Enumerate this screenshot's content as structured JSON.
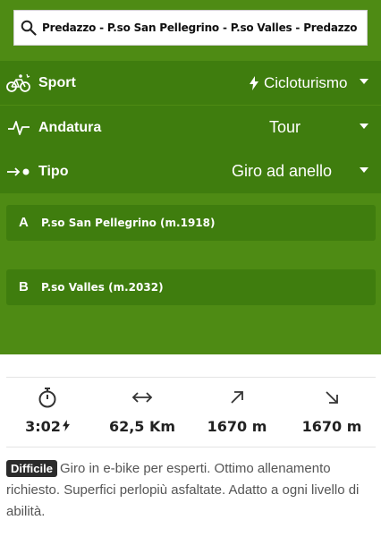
{
  "search": {
    "value": "Predazzo - P.so San Pellegrino - P.so Valles - Predazzo"
  },
  "filters": [
    {
      "label": "Sport",
      "value": "Cicloturismo",
      "icon": "bicycle-icon"
    },
    {
      "label": "Andatura",
      "value": "Tour",
      "icon": "pulse-icon"
    },
    {
      "label": "Tipo",
      "value": "Giro ad anello",
      "icon": "loop-arrow-icon"
    }
  ],
  "waypoints": [
    {
      "letter": "A",
      "name": "P.so San Pellegrino (m.1918)"
    },
    {
      "letter": "B",
      "name": "P.so Valles (m.2032)"
    }
  ],
  "stats": {
    "time": "3:02",
    "distance": "62,5 Km",
    "ascent": "1670 m",
    "descent": "1670 m"
  },
  "description": {
    "badge": "Difficile",
    "text": "Giro in e-bike per esperti. Ottimo allenamento richiesto. Superfici perlopiù asfaltate. Adatto a ogni livello di abilità."
  },
  "colors": {
    "green_bg": "#4e8b14",
    "green_row": "#3f7d0e"
  }
}
